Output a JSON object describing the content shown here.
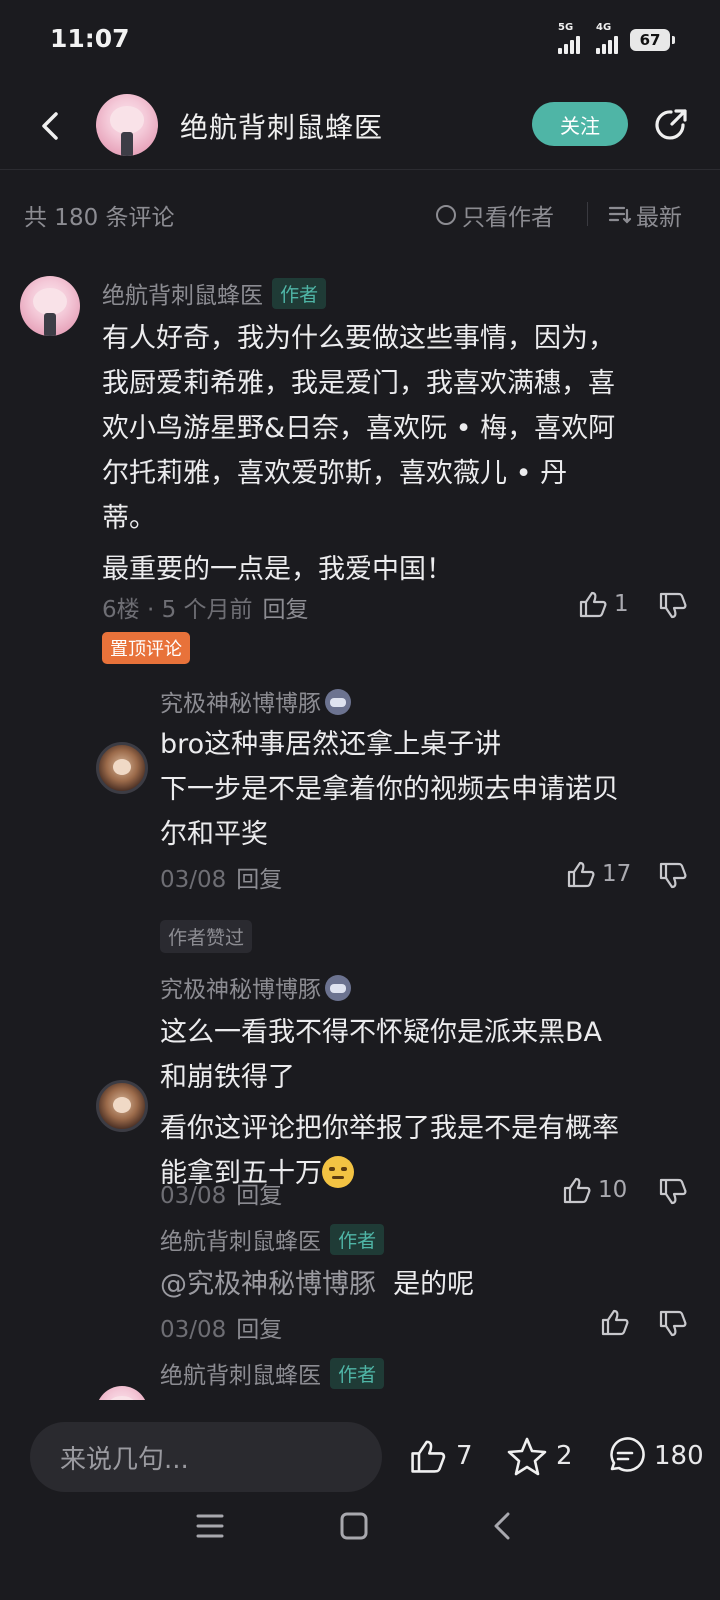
{
  "status": {
    "time": "11:07",
    "net1": "5G",
    "net2": "4G",
    "battery": "67"
  },
  "header": {
    "title": "绝航背刺鼠蜂医",
    "follow_label": "关注"
  },
  "filter": {
    "count_text": "共 180 条评论",
    "only_author": "只看作者",
    "newest": "最新"
  },
  "comments": [
    {
      "name": "绝航背刺鼠蜂医",
      "badge": "作者",
      "lines": [
        "有人好奇，我为什么要做这些事情，因为，",
        "我厨爱莉希雅，我是爱门，我喜欢满穗，喜",
        "欢小鸟游星野&日奈，喜欢阮 • 梅，喜欢阿",
        "尔托莉雅，喜欢爱弥斯，喜欢薇儿 • 丹",
        "蒂。",
        "最重要的一点是，我爱中国！"
      ],
      "meta": "6楼 · 5 个月前",
      "reply": "回复",
      "likes": "1",
      "pin": "置顶评论"
    }
  ],
  "replies": [
    {
      "name": "究极神秘博博豚",
      "lines": [
        "bro这种事居然还拿上桌子讲",
        "下一步是不是拿着你的视频去申请诺贝",
        "尔和平奖"
      ],
      "date": "03/08",
      "reply": "回复",
      "likes": "17",
      "liked_badge": "作者赞过"
    },
    {
      "name": "究极神秘博博豚",
      "lines": [
        "这么一看我不得不怀疑你是派来黑BA",
        "和崩铁得了",
        "看你这评论把你举报了我是不是有概率",
        "能拿到五十万"
      ],
      "date": "03/08",
      "reply": "回复",
      "likes": "10"
    },
    {
      "name": "绝航背刺鼠蜂医",
      "badge": "作者",
      "mention": "@究极神秘博博豚",
      "text": "是的呢",
      "date": "03/08",
      "reply": "回复"
    },
    {
      "name": "绝航背刺鼠蜂医",
      "badge": "作者"
    }
  ],
  "bottom": {
    "placeholder": "来说几句...",
    "likes": "7",
    "stars": "2",
    "comments": "180"
  }
}
